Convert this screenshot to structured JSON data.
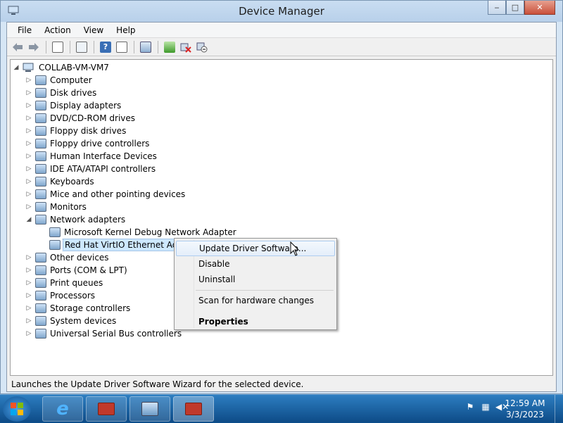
{
  "window": {
    "title": "Device Manager",
    "controls": {
      "minimize": "‒",
      "maximize": "□",
      "close": "✕"
    }
  },
  "menubar": {
    "items": [
      {
        "label": "File"
      },
      {
        "label": "Action"
      },
      {
        "label": "View"
      },
      {
        "label": "Help"
      }
    ]
  },
  "toolbar": {
    "icons": [
      "back-arrow-icon",
      "forward-arrow-icon",
      "show-hide-console-tree-icon",
      "properties-icon",
      "help-icon",
      "show-hide-action-pane-icon",
      "scan-hardware-icon",
      "update-driver-icon",
      "uninstall-icon",
      "disable-icon"
    ]
  },
  "tree": {
    "root": "COLLAB-VM-VM7",
    "nodes": [
      {
        "label": "Computer",
        "icon": "computer-icon"
      },
      {
        "label": "Disk drives",
        "icon": "disk-drive-icon"
      },
      {
        "label": "Display adapters",
        "icon": "display-adapter-icon"
      },
      {
        "label": "DVD/CD-ROM drives",
        "icon": "dvd-drive-icon"
      },
      {
        "label": "Floppy disk drives",
        "icon": "floppy-drive-icon"
      },
      {
        "label": "Floppy drive controllers",
        "icon": "floppy-controller-icon"
      },
      {
        "label": "Human Interface Devices",
        "icon": "hid-icon"
      },
      {
        "label": "IDE ATA/ATAPI controllers",
        "icon": "ide-controller-icon"
      },
      {
        "label": "Keyboards",
        "icon": "keyboard-icon"
      },
      {
        "label": "Mice and other pointing devices",
        "icon": "mouse-icon"
      },
      {
        "label": "Monitors",
        "icon": "monitor-icon"
      },
      {
        "label": "Network adapters",
        "icon": "network-adapter-icon"
      },
      {
        "label": "Microsoft Kernel Debug Network Adapter",
        "icon": "network-adapter-icon"
      },
      {
        "label": "Red Hat VirtIO Ethernet Adap",
        "icon": "network-adapter-icon"
      },
      {
        "label": "Other devices",
        "icon": "other-devices-icon"
      },
      {
        "label": "Ports (COM & LPT)",
        "icon": "port-icon"
      },
      {
        "label": "Print queues",
        "icon": "printer-icon"
      },
      {
        "label": "Processors",
        "icon": "processor-icon"
      },
      {
        "label": "Storage controllers",
        "icon": "storage-controller-icon"
      },
      {
        "label": "System devices",
        "icon": "system-device-icon"
      },
      {
        "label": "Universal Serial Bus controllers",
        "icon": "usb-icon"
      }
    ]
  },
  "context_menu": {
    "items": [
      {
        "label": "Update Driver Software..."
      },
      {
        "label": "Disable"
      },
      {
        "label": "Uninstall"
      },
      {
        "label": "Scan for hardware changes"
      },
      {
        "label": "Properties"
      }
    ]
  },
  "statusbar": {
    "text": "Launches the Update Driver Software Wizard for the selected device."
  },
  "taskbar": {
    "apps": [
      "internet-explorer-icon",
      "toolbox-icon",
      "control-panel-icon",
      "device-manager-icon"
    ],
    "tray_icons": [
      "flag-icon",
      "network-icon",
      "volume-muted-icon"
    ],
    "time": "12:59 AM",
    "date": "3/3/2023"
  }
}
